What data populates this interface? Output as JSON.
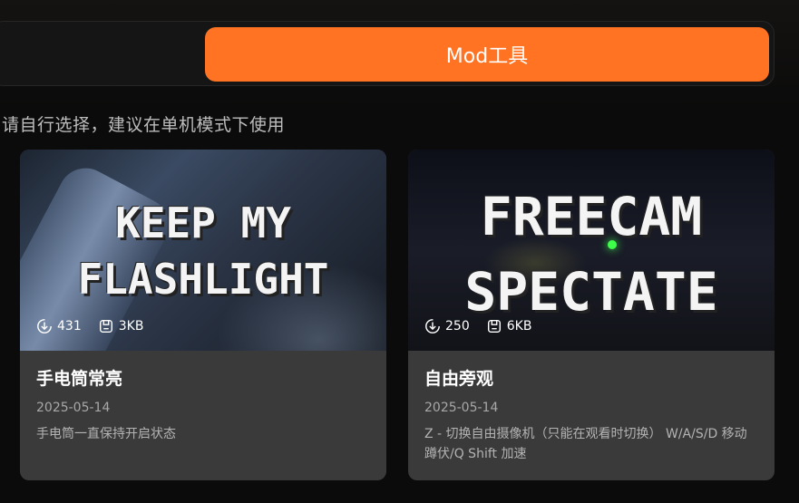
{
  "tabs": {
    "active_label": "Mod工具"
  },
  "hint": "请自行选择，建议在单机模式下使用",
  "cards": [
    {
      "thumb_lines": [
        "KEEP MY",
        "FLASHLIGHT"
      ],
      "downloads": "431",
      "size": "3KB",
      "title": "手电筒常亮",
      "date": "2025-05-14",
      "description": "手电筒一直保持开启状态"
    },
    {
      "thumb_lines": [
        "FREECAM",
        "SPECTATE"
      ],
      "downloads": "250",
      "size": "6KB",
      "title": "自由旁观",
      "date": "2025-05-14",
      "description": "Z - 切换自由摄像机（只能在观看时切换） W/A/S/D 移动 蹲伏/Q Shift 加速"
    }
  ],
  "colors": {
    "accent": "#ff7323",
    "card_bg": "#3a3a3a",
    "page_bg": "#0b0b0b"
  },
  "icons": {
    "downloads": "download-icon",
    "size": "file-size-icon"
  }
}
